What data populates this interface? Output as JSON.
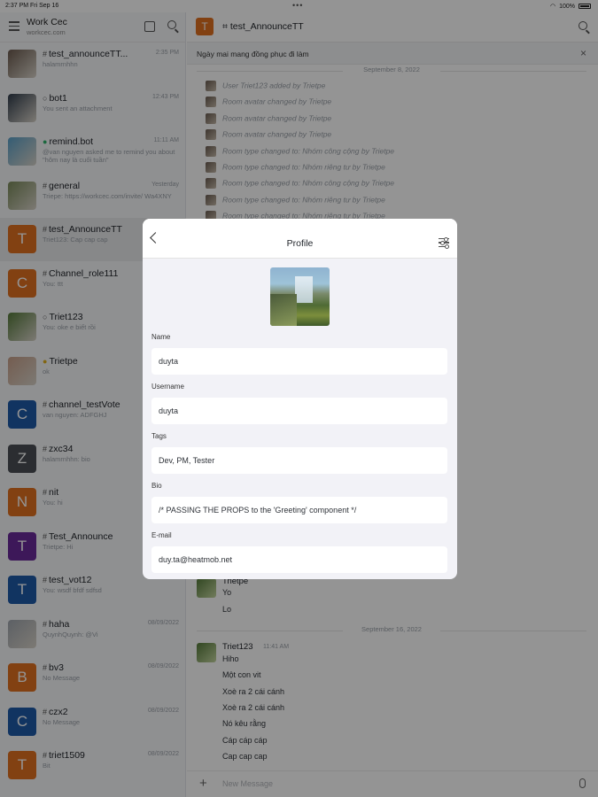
{
  "status_bar": {
    "time": "2:37 PM  Fri Sep 16",
    "dots": "•••",
    "battery": "100%"
  },
  "sidebar": {
    "workspace_name": "Work Cec",
    "workspace_url": "workcec.com",
    "rooms": [
      {
        "prefix": "#",
        "title": "test_announceTT...",
        "date": "2:35 PM",
        "sub": "halamrnhhn",
        "avatar_letter": "",
        "avatar_color": "#6b5a4e"
      },
      {
        "prefix": "○",
        "title": "bot1",
        "date": "12:43 PM",
        "sub": "You sent an attachment",
        "avatar_letter": "",
        "avatar_color": "#2f3b4a"
      },
      {
        "prefix": "●",
        "title": "remind.bot",
        "date": "11:11 AM",
        "sub": "@van nguyen asked me to remind you about \"hôm nay là cuối tuần\"",
        "avatar_letter": "",
        "avatar_color": "#5aa0c8"
      },
      {
        "prefix": "#",
        "title": "general",
        "date": "Yesterday",
        "sub": "Triepe: https://workcec.com/invite/ Wa4XNY",
        "avatar_letter": "",
        "avatar_color": "#7a8a5a"
      },
      {
        "prefix": "#",
        "title": "test_AnnounceTT",
        "date": "",
        "sub": "Triet123: Cap cap cap",
        "avatar_letter": "T",
        "avatar_color": "#e0701f"
      },
      {
        "prefix": "#",
        "title": "Channel_role111",
        "date": "",
        "sub": "You: ttt",
        "avatar_letter": "C",
        "avatar_color": "#e0701f"
      },
      {
        "prefix": "○",
        "title": "Triet123",
        "date": "",
        "sub": "You: oke e biết rồi",
        "avatar_letter": "",
        "avatar_color": "#557a3a"
      },
      {
        "prefix": "●",
        "title": "Trietpe",
        "date": "",
        "sub": "ok",
        "avatar_letter": "",
        "avatar_color": "#c8a08a"
      },
      {
        "prefix": "#",
        "title": "channel_testVote",
        "date": "",
        "sub": "van nguyen: ADFGHJ",
        "avatar_letter": "C",
        "avatar_color": "#1e5aa8"
      },
      {
        "prefix": "#",
        "title": "zxc34",
        "date": "",
        "sub": "halamrnhhn: bio",
        "avatar_letter": "Z",
        "avatar_color": "#4a4e55"
      },
      {
        "prefix": "#",
        "title": "nit",
        "date": "",
        "sub": "You: hi",
        "avatar_letter": "N",
        "avatar_color": "#e0701f"
      },
      {
        "prefix": "#",
        "title": "Test_Announce",
        "date": "",
        "sub": "Trietpe: Hi",
        "avatar_letter": "T",
        "avatar_color": "#6a2a9a"
      },
      {
        "prefix": "#",
        "title": "test_vot12",
        "date": "",
        "sub": "You: wsdf bfdf sdfsd",
        "avatar_letter": "T",
        "avatar_color": "#1e5aa8"
      },
      {
        "prefix": "#",
        "title": "haha",
        "date": "08/09/2022",
        "sub": "QuynhQuynh: @Vi",
        "avatar_letter": "",
        "avatar_color": "#a0a6ae"
      },
      {
        "prefix": "#",
        "title": "bv3",
        "date": "08/09/2022",
        "sub": "No Message",
        "avatar_letter": "B",
        "avatar_color": "#e0701f"
      },
      {
        "prefix": "#",
        "title": "czx2",
        "date": "08/09/2022",
        "sub": "No Message",
        "avatar_letter": "C",
        "avatar_color": "#1e5aa8"
      },
      {
        "prefix": "#",
        "title": "triet1509",
        "date": "08/09/2022",
        "sub": "Bit",
        "avatar_letter": "T",
        "avatar_color": "#e0701f"
      }
    ]
  },
  "chat": {
    "room_name": "test_AnnounceTT",
    "room_avatar_letter": "T",
    "announcement": "Ngày mai mang đồng phục đi làm",
    "date_divider_1": "September 8, 2022",
    "system_messages": [
      "User Triet123 added by Trietpe",
      "Room avatar changed by Trietpe",
      "Room avatar changed by Trietpe",
      "Room avatar changed by Trietpe",
      "Room type changed to: Nhóm công cộng by Trietpe",
      "Room type changed to: Nhóm riêng tư by Trietpe",
      "Room type changed to: Nhóm công cộng by Trietpe",
      "Room type changed to: Nhóm riêng tư by Trietpe",
      "Room type changed to: Nhóm riêng tư by Trietpe"
    ],
    "partial_message": {
      "name": "Trietpe",
      "lines": [
        "Yo",
        "Lo"
      ]
    },
    "date_divider_2": "September 16, 2022",
    "last_message": {
      "name": "Triet123",
      "time": "11:41 AM",
      "lines": [
        "Hiho",
        "Một con vit",
        "Xoè ra 2 cái cánh",
        "Xoè ra 2 cái cánh",
        "Nó kêu rằng",
        "Cáp cáp cáp",
        "Cap cap cap"
      ]
    },
    "composer_placeholder": "New Message"
  },
  "modal": {
    "title": "Profile",
    "fields": [
      {
        "label": "Name",
        "value": "duyta"
      },
      {
        "label": "Username",
        "value": "duyta"
      },
      {
        "label": "Tags",
        "value": "Dev, PM, Tester"
      },
      {
        "label": "Bio",
        "value": "/* PASSING THE PROPS to the 'Greeting' component */"
      },
      {
        "label": "E-mail",
        "value": "duy.ta@heatmob.net"
      }
    ]
  }
}
